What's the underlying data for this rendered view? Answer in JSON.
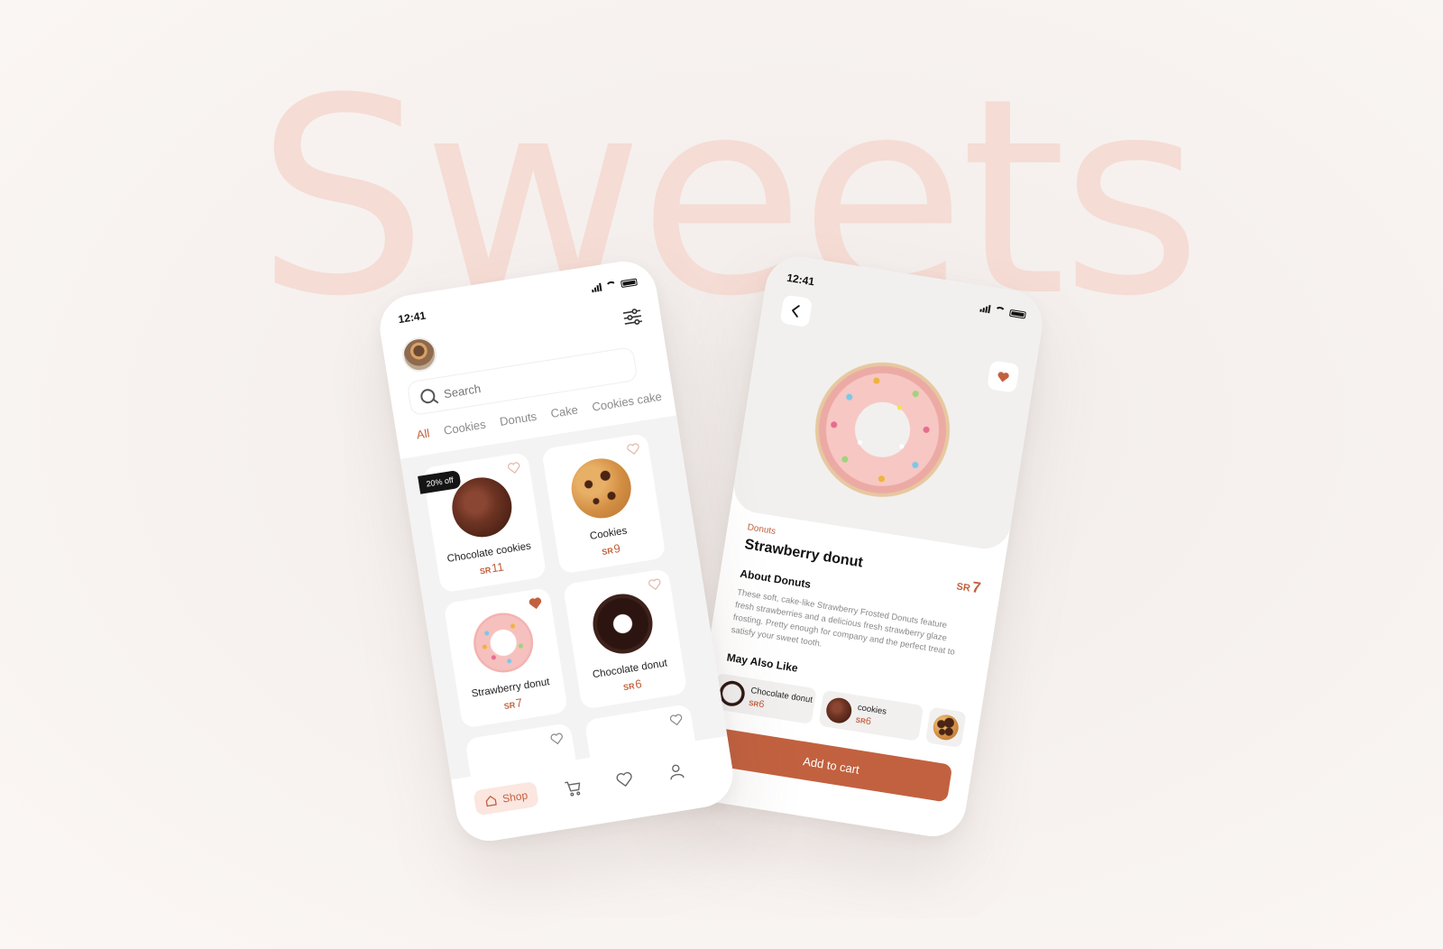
{
  "background_title": "Sweets",
  "colors": {
    "accent": "#c2613f",
    "accent_light": "#fbe6e0",
    "card_bg": "#f4f3f3"
  },
  "status_bar": {
    "time": "12:41"
  },
  "shop_screen": {
    "search": {
      "placeholder": "Search"
    },
    "categories": [
      "All",
      "Cookies",
      "Donuts",
      "Cake",
      "Cookies cake"
    ],
    "active_category": "All",
    "currency": "SR",
    "products": [
      {
        "name": "Chocolate cookies",
        "price": "11",
        "badge": "20% off",
        "favorite": false,
        "icon": "chocolate-cookie-image"
      },
      {
        "name": "Cookies",
        "price": "9",
        "favorite": false,
        "icon": "cookie-image"
      },
      {
        "name": "Strawberry donut",
        "price": "7",
        "favorite": true,
        "icon": "strawberry-donut-image"
      },
      {
        "name": "Chocolate donut",
        "price": "6",
        "favorite": false,
        "icon": "chocolate-donut-image"
      }
    ],
    "bottom_nav": {
      "shop_label": "Shop",
      "items": [
        "home-icon",
        "cart-icon",
        "heart-icon",
        "profile-icon"
      ]
    }
  },
  "detail_screen": {
    "category": "Donuts",
    "title": "Strawberry donut",
    "currency": "SR",
    "price": "7",
    "about_heading": "About Donuts",
    "description": "These soft, cake-like Strawberry Frosted Donuts feature fresh strawberries and a delicious fresh strawberry glaze frosting. Pretty enough for company and the perfect treat to satisfy your sweet tooth.",
    "may_also_like_heading": "May Also Like",
    "may_also_like": [
      {
        "name": "Chocolate donut",
        "price": "6"
      },
      {
        "name": "cookies",
        "price": "6"
      }
    ],
    "add_to_cart_label": "Add to cart"
  }
}
